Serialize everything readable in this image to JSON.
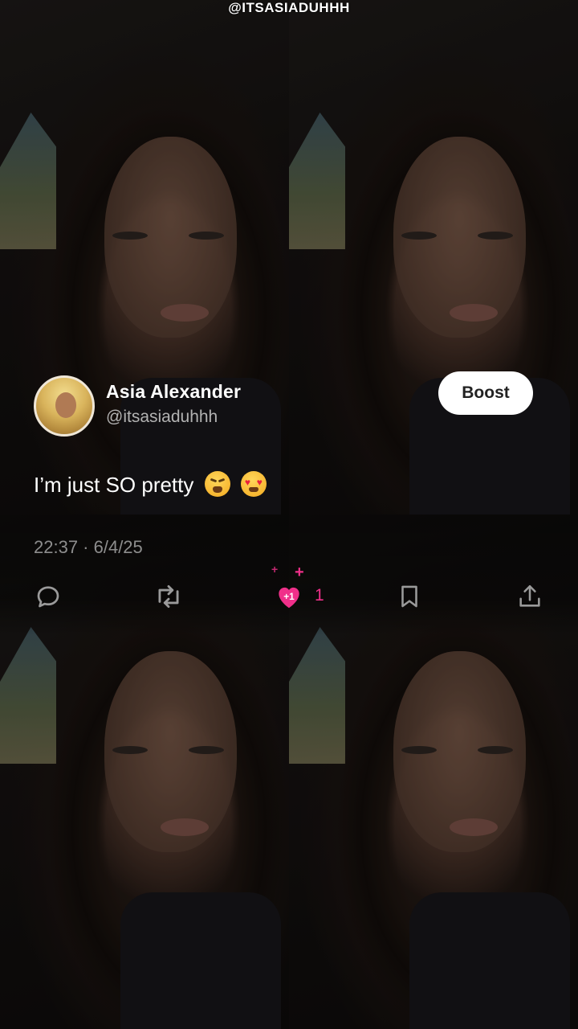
{
  "watermark": "@ITSASIADUHHH",
  "tweet": {
    "display_name": "Asia Alexander",
    "handle": "@itsasiaduhhh",
    "text": "I’m just SO pretty",
    "emojis": [
      "weary-face",
      "smiling-face-with-heart-eyes"
    ],
    "timestamp": "22:37 · 6/4/25"
  },
  "boost_button": {
    "label": "Boost"
  },
  "actions": {
    "reply_icon": "speech-bubble-icon",
    "retweet_icon": "retweet-icon",
    "like": {
      "icon": "heart-icon",
      "badge": "+1",
      "count": "1",
      "color": "#f0308a"
    },
    "bookmark_icon": "bookmark-icon",
    "share_icon": "share-icon"
  },
  "colors": {
    "accent_pink": "#f0308a",
    "muted_text": "#8d8d8d"
  }
}
